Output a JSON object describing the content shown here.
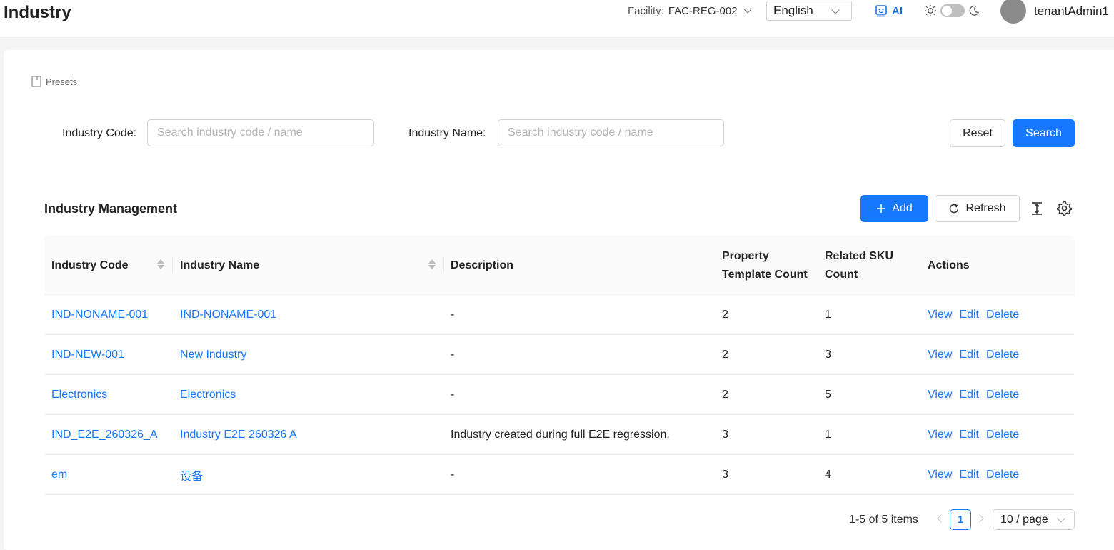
{
  "header": {
    "title": "Industry",
    "facility_label": "Facility:",
    "facility_value": "FAC-REG-002",
    "language": "English",
    "ai_label": "AI",
    "username": "tenantAdmin1"
  },
  "presets_label": "Presets",
  "search": {
    "code_label": "Industry Code",
    "code_placeholder": "Search industry code / name",
    "name_label": "Industry Name",
    "name_placeholder": "Search industry code / name",
    "reset_label": "Reset",
    "search_label": "Search"
  },
  "table_section": {
    "title": "Industry Management",
    "add_label": "Add",
    "refresh_label": "Refresh"
  },
  "table": {
    "columns": [
      "Industry Code",
      "Industry Name",
      "Description",
      "Property Template Count",
      "Related SKU Count",
      "Actions"
    ],
    "col_property_line1": "Property",
    "col_property_line2": "Template Count",
    "col_sku_line1": "Related SKU",
    "col_sku_line2": "Count",
    "action_labels": {
      "view": "View",
      "edit": "Edit",
      "delete": "Delete"
    },
    "rows": [
      {
        "code": "IND-NONAME-001",
        "name": "IND-NONAME-001",
        "description": "-",
        "property_count": "2",
        "sku_count": "1"
      },
      {
        "code": "IND-NEW-001",
        "name": "New Industry",
        "description": "-",
        "property_count": "2",
        "sku_count": "3"
      },
      {
        "code": "Electronics",
        "name": "Electronics",
        "description": "-",
        "property_count": "2",
        "sku_count": "5"
      },
      {
        "code": "IND_E2E_260326_A",
        "name": "Industry E2E 260326 A",
        "description": "Industry created during full E2E regression.",
        "property_count": "3",
        "sku_count": "1"
      },
      {
        "code": "em",
        "name": "设备",
        "description": "-",
        "property_count": "3",
        "sku_count": "4"
      }
    ]
  },
  "pagination": {
    "total_text": "1-5 of 5 items",
    "current_page": "1",
    "page_size": "10 / page"
  },
  "colors": {
    "primary": "#1677ff",
    "link": "#1677ff",
    "ai": "#1d6fd8"
  }
}
